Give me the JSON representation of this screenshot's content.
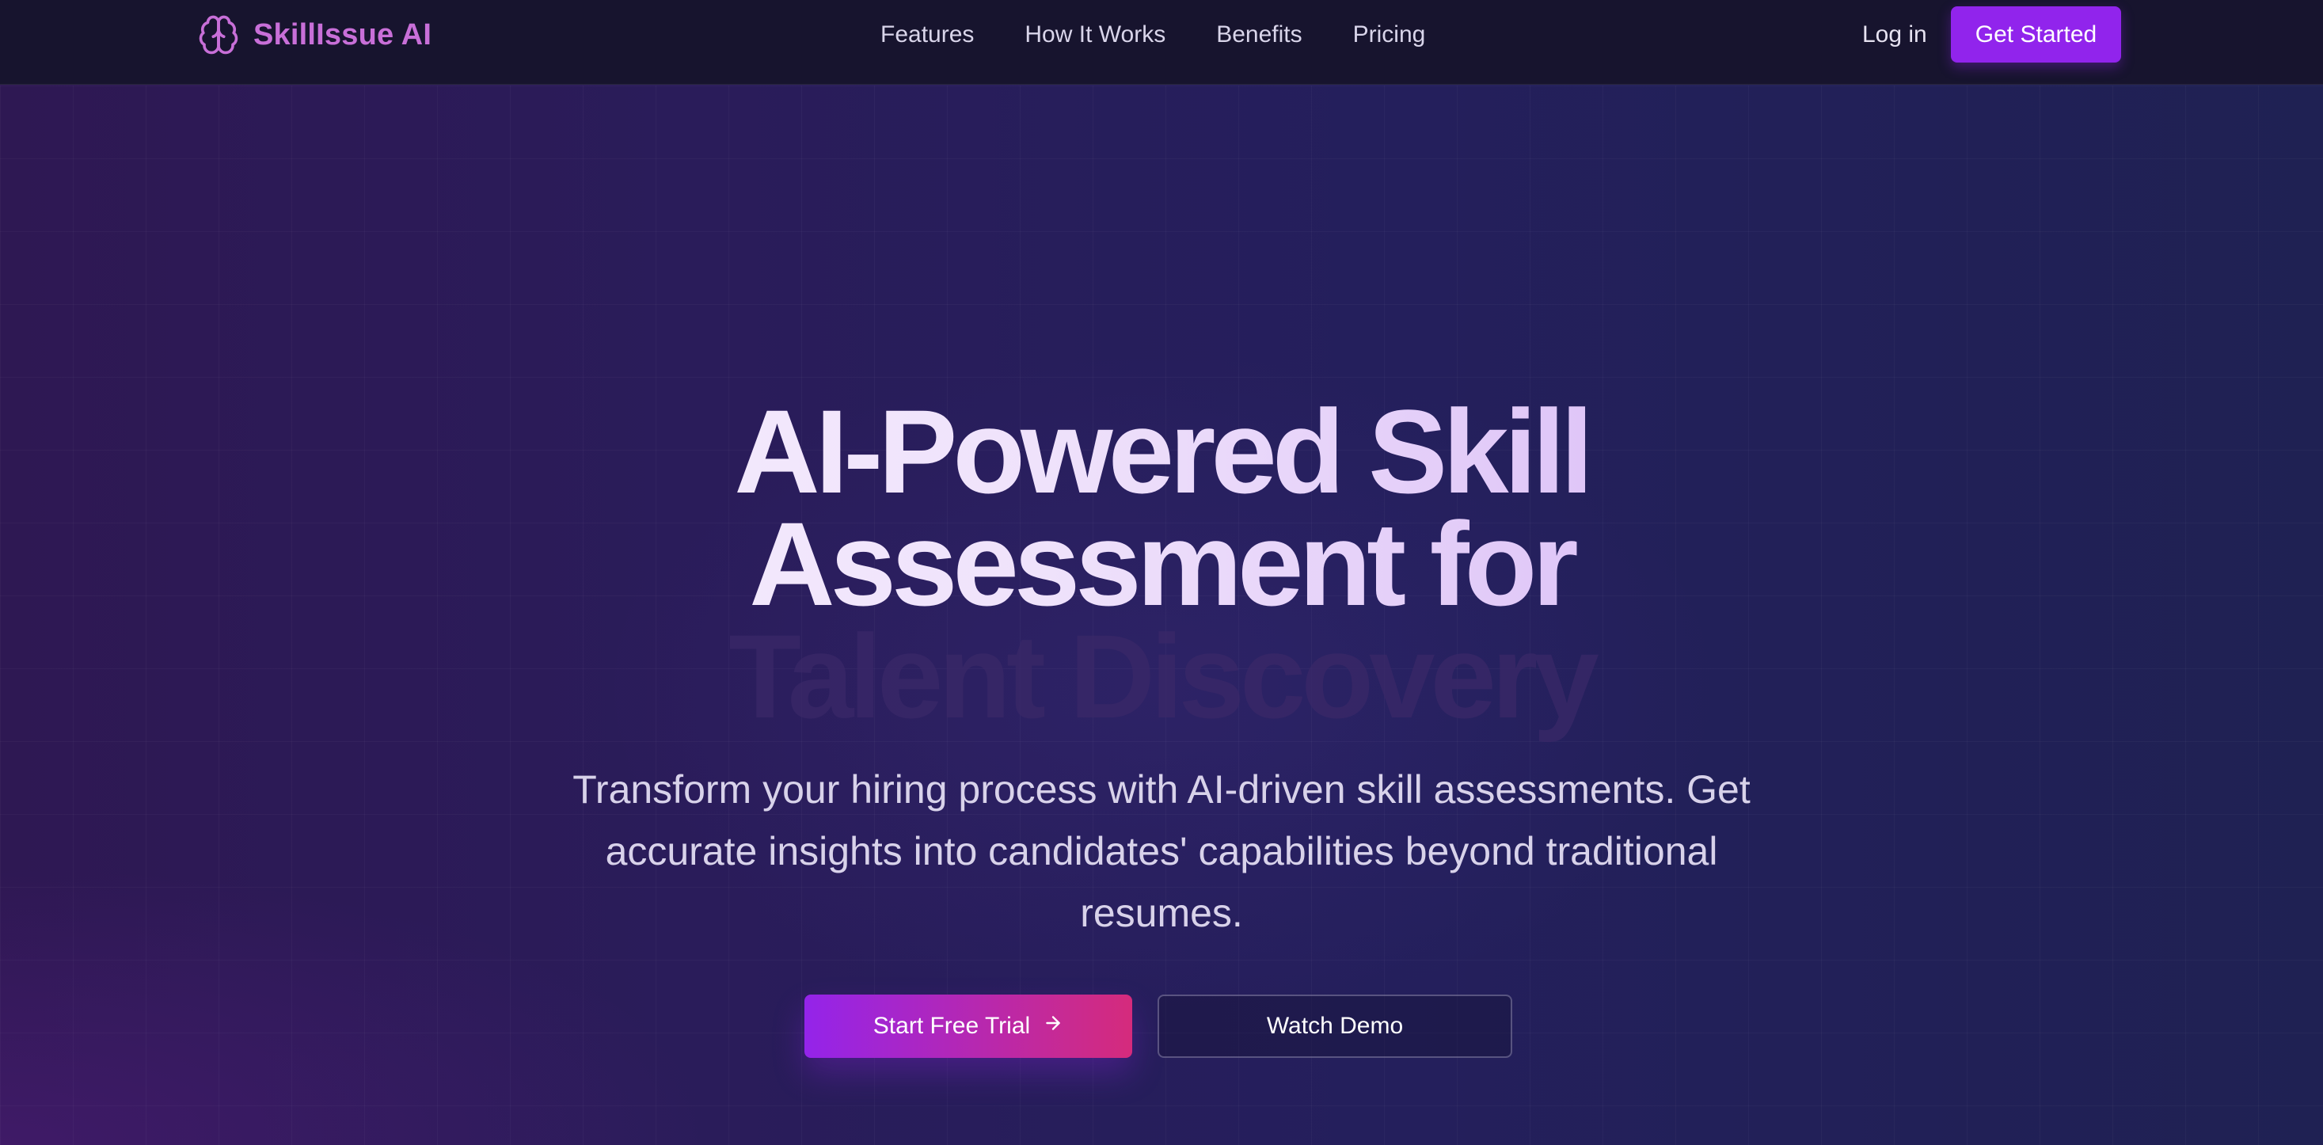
{
  "brand": {
    "name": "SkillIssue AI",
    "icon": "brain-icon",
    "color": "#c86fd8"
  },
  "nav": {
    "links": [
      "Features",
      "How It Works",
      "Benefits",
      "Pricing"
    ],
    "login": "Log in",
    "cta": "Get Started"
  },
  "hero": {
    "title_line1": "AI-Powered Skill",
    "title_line2": "Assessment for",
    "title_line3": "Talent Discovery",
    "subtitle": "Transform your hiring process with AI-driven skill assessments. Get accurate insights into candidates' capabilities beyond traditional resumes.",
    "primary_cta": "Start Free Trial",
    "primary_cta_icon": "arrow-right-icon",
    "secondary_cta": "Watch Demo"
  },
  "colors": {
    "accent": "#9124ec",
    "gradient_start": "#9424ea",
    "gradient_end": "#d52b7c",
    "nav_bg": "#17142e"
  }
}
